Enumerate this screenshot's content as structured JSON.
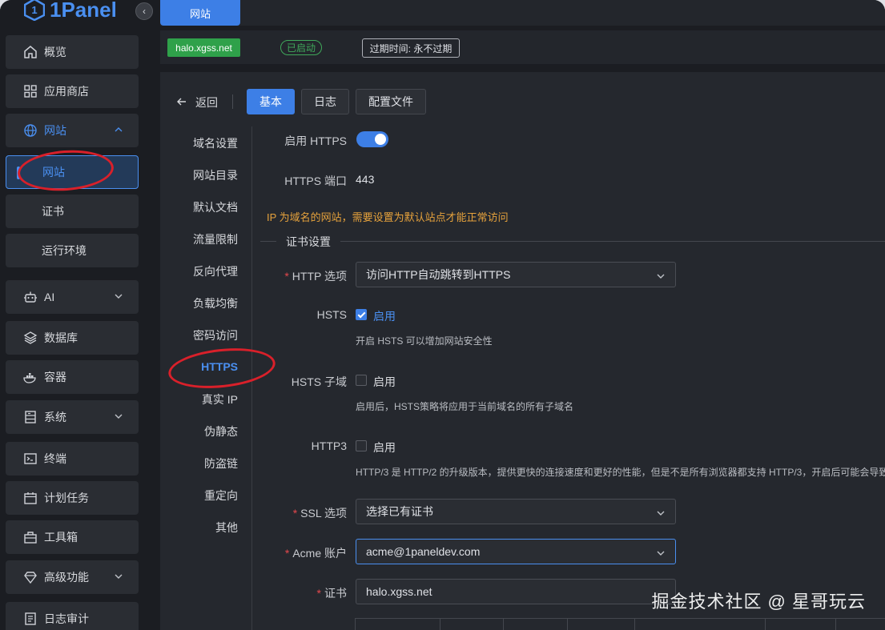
{
  "app": {
    "logo": "1Panel"
  },
  "sidebar": {
    "items": [
      {
        "label": "概览",
        "icon": "home-icon"
      },
      {
        "label": "应用商店",
        "icon": "grid-icon"
      },
      {
        "label": "网站",
        "icon": "globe-icon"
      },
      {
        "label": "网站"
      },
      {
        "label": "证书"
      },
      {
        "label": "运行环境"
      },
      {
        "label": "AI",
        "icon": "robot-icon"
      },
      {
        "label": "数据库",
        "icon": "layers-icon"
      },
      {
        "label": "容器",
        "icon": "docker-icon"
      },
      {
        "label": "系统",
        "icon": "server-icon"
      },
      {
        "label": "终端",
        "icon": "terminal-icon"
      },
      {
        "label": "计划任务",
        "icon": "calendar-icon"
      },
      {
        "label": "工具箱",
        "icon": "toolbox-icon"
      },
      {
        "label": "高级功能",
        "icon": "diamond-icon"
      },
      {
        "label": "日志审计",
        "icon": "log-icon"
      }
    ]
  },
  "topbar": {
    "tab": "网站"
  },
  "site": {
    "domain": "halo.xgss.net",
    "status": "已启动",
    "expire": "过期时间: 永不过期"
  },
  "toolbar": {
    "back": "返回",
    "tabs": [
      "基本",
      "日志",
      "配置文件"
    ]
  },
  "subnav": [
    "域名设置",
    "网站目录",
    "默认文档",
    "流量限制",
    "反向代理",
    "负载均衡",
    "密码访问",
    "HTTPS",
    "真实 IP",
    "伪静态",
    "防盗链",
    "重定向",
    "其他"
  ],
  "form": {
    "enable_https_label": "启用 HTTPS",
    "https_port_label": "HTTPS 端口",
    "https_port": "443",
    "warning": "IP 为域名的网站，需要设置为默认站点才能正常访问",
    "cert_section": "证书设置",
    "http_option_label": "HTTP 选项",
    "http_option_value": "访问HTTP自动跳转到HTTPS",
    "hsts_label": "HSTS",
    "hsts_enable": "启用",
    "hsts_hint": "开启 HSTS 可以增加网站安全性",
    "hsts_sub_label": "HSTS 子域",
    "hsts_sub_enable": "启用",
    "hsts_sub_hint": "启用后，HSTS策略将应用于当前域名的所有子域名",
    "http3_label": "HTTP3",
    "http3_enable": "启用",
    "http3_hint": "HTTP/3 是 HTTP/2 的升级版本，提供更快的连接速度和更好的性能，但是不是所有浏览器都支持 HTTP/3，开启后可能会导致",
    "ssl_label": "SSL 选项",
    "ssl_value": "选择已有证书",
    "acme_label": "Acme 账户",
    "acme_value": "acme@1paneldev.com",
    "cert_label": "证书",
    "cert_value": "halo.xgss.net",
    "required_mark": "*"
  },
  "watermark": "掘金技术社区 @ 星哥玩云",
  "colors": {
    "primary": "#3d7fe6",
    "success": "#2fa14a",
    "warning": "#e6a23c",
    "annotation": "#d9202a"
  }
}
